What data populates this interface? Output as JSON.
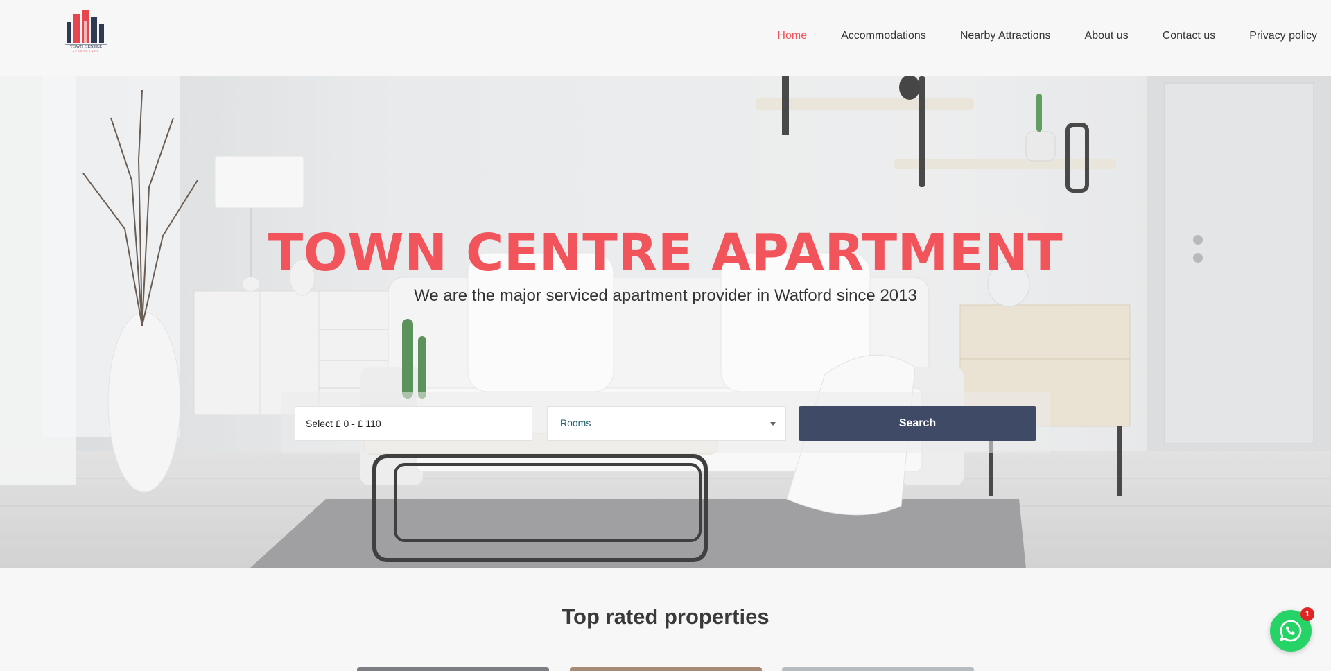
{
  "logo": {
    "text": "TOWN CENTRE",
    "subtext": "APARTMENTS"
  },
  "nav": {
    "items": [
      {
        "label": "Home",
        "active": true
      },
      {
        "label": "Accommodations",
        "active": false
      },
      {
        "label": "Nearby Attractions",
        "active": false
      },
      {
        "label": "About us",
        "active": false
      },
      {
        "label": "Contact us",
        "active": false
      },
      {
        "label": "Privacy policy",
        "active": false
      }
    ]
  },
  "hero": {
    "title": "TOWN CENTRE APARTMENT",
    "subtitle": "We are the major serviced apartment provider in Watford since 2013",
    "title_color": "#f2545b"
  },
  "search": {
    "price_value": "Select £ 0 - £ 110",
    "rooms_value": "Rooms",
    "button_label": "Search",
    "button_color": "#3e4a66"
  },
  "section": {
    "title": "Top rated properties"
  },
  "whatsapp": {
    "badge_count": "1",
    "icon": "whatsapp-icon"
  }
}
